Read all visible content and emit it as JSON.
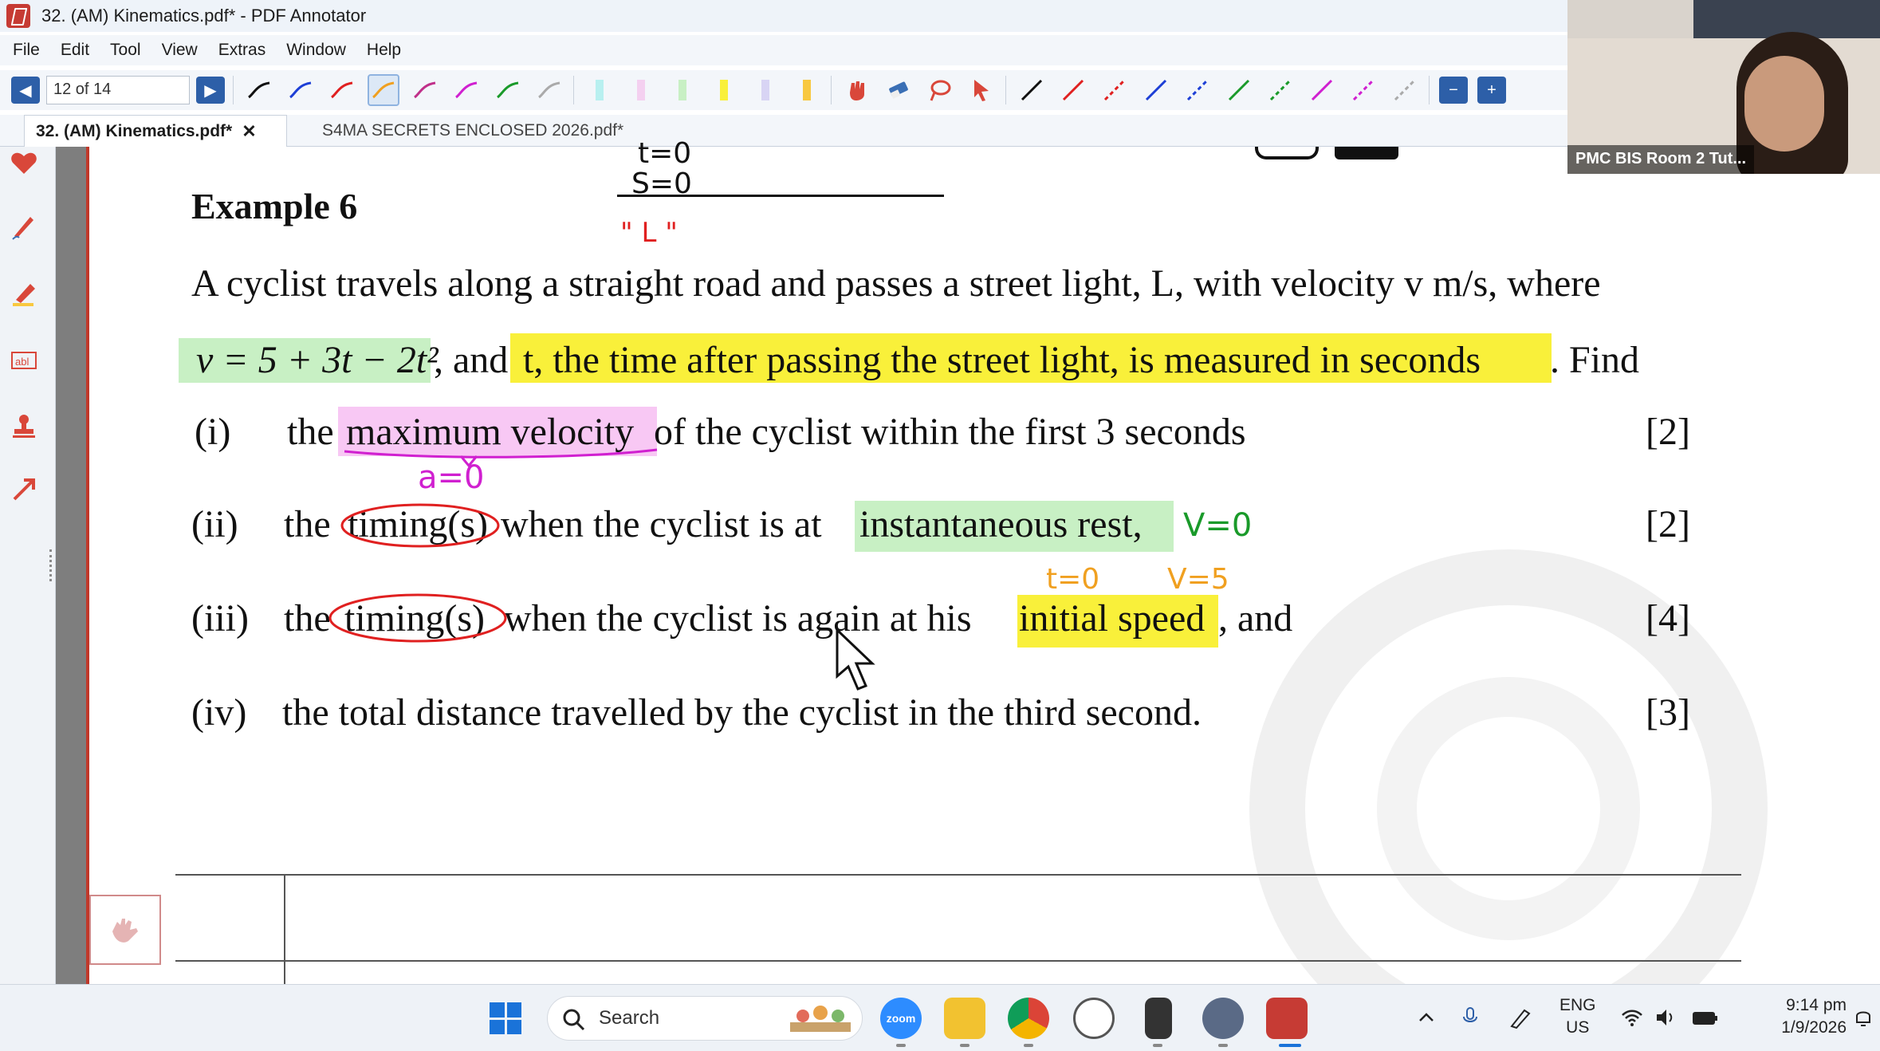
{
  "window": {
    "title": "32. (AM) Kinematics.pdf* - PDF Annotator"
  },
  "menu": [
    "File",
    "Edit",
    "Tool",
    "View",
    "Extras",
    "Window",
    "Help"
  ],
  "toolbar": {
    "page_indicator": "12 of 14"
  },
  "tabs": [
    {
      "label": "32. (AM) Kinematics.pdf*",
      "close": "✕"
    },
    {
      "label": "S4MA SECRETS ENCLOSED 2026.pdf*"
    }
  ],
  "webcam": {
    "label": "PMC BIS Room 2 Tut..."
  },
  "document": {
    "heading": "Example 6",
    "line1": "A cyclist travels along a straight road and passes a street light, L, with velocity v m/s, where",
    "line2_formula": "v = 5 + 3t − 2t²",
    "line2_mid": ", and ",
    "line2_highlight": "t, the time after passing the street light, is measured in seconds",
    "line2_end": ". Find",
    "parts": [
      {
        "num": "(i)",
        "pre": "the ",
        "key": "maximum velocity",
        "post": " of the cyclist within the first 3 seconds",
        "marks": "[2]"
      },
      {
        "num": "(ii)",
        "pre": "the ",
        "key": "timing(s)",
        "mid": " when the cyclist is at ",
        "key2": "instantaneous rest,",
        "marks": "[2]"
      },
      {
        "num": "(iii)",
        "pre": "the ",
        "key": "timing(s)",
        "mid": " when the cyclist is again at his ",
        "key2": "initial speed",
        "post": ", and",
        "marks": "[4]"
      },
      {
        "num": "(iv)",
        "pre": "the total distance travelled by the cyclist in the third second.",
        "marks": "[3]"
      }
    ],
    "ink": {
      "t0": "t=0",
      "s0": "S=0",
      "L": "\" L \"",
      "a0": "a=0",
      "v0": "V=0",
      "t0b": "t=0",
      "v5": "V=5"
    }
  },
  "taskbar": {
    "search": "Search",
    "zoom_label": "zoom",
    "lang_top": "ENG",
    "lang_bottom": "US",
    "time": "9:14 pm",
    "date": "1/9/2026"
  }
}
